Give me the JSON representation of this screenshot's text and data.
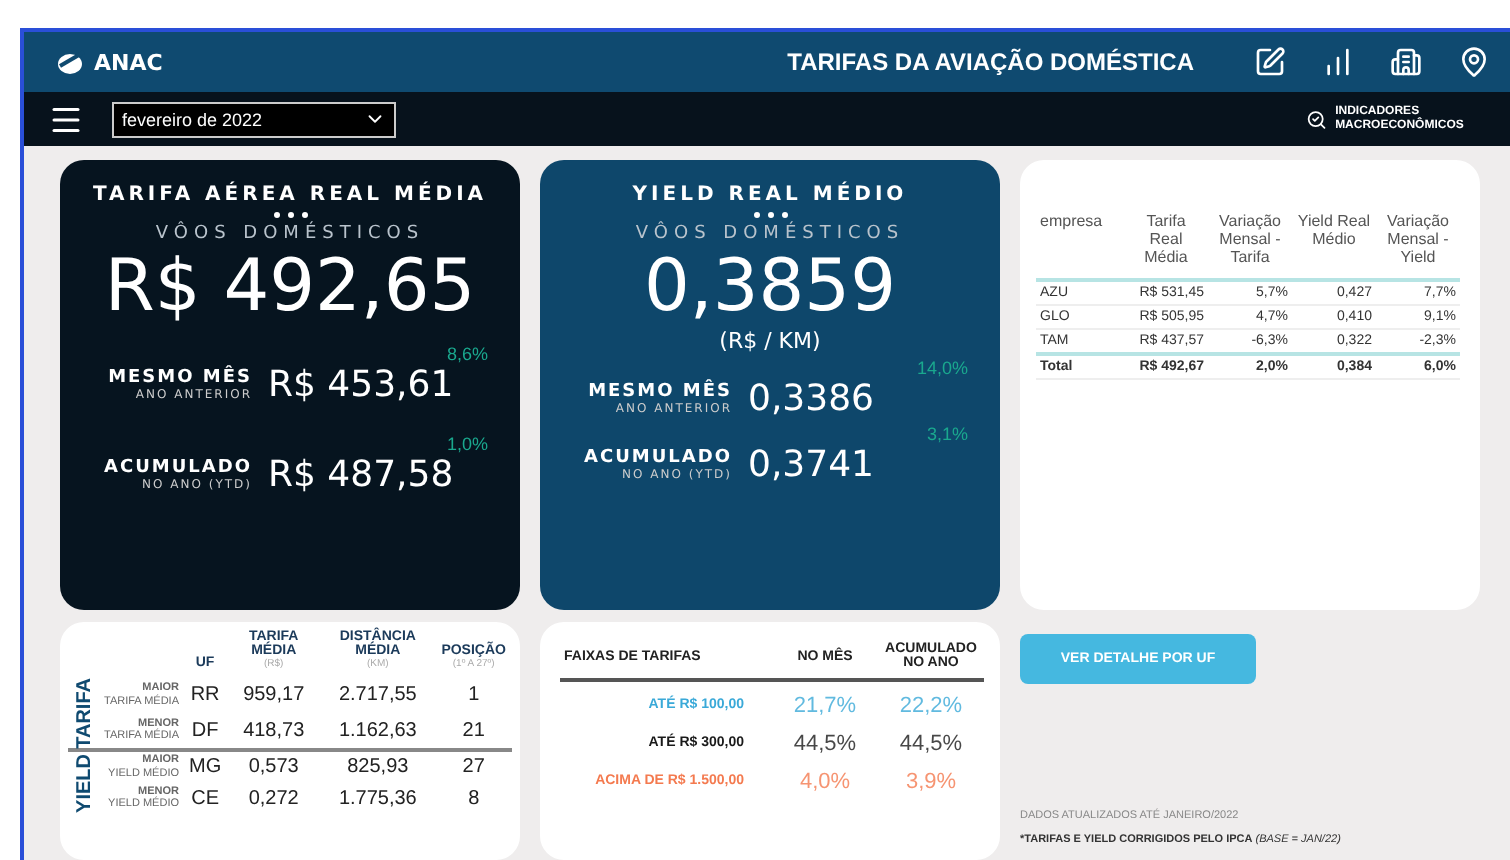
{
  "header": {
    "logo": "ANAC",
    "title": "TARIFAS DA AVIAÇÃO DOMÉSTICA"
  },
  "toolbar": {
    "period": "fevereiro de 2022",
    "link": "INDICADORES MACROECONÔMICOS"
  },
  "kpis": [
    {
      "kind": "tarifa",
      "title": "TARIFA AÉREA REAL MÉDIA",
      "subtitle": "VÔOS DOMÉSTICOS",
      "big": "R$ 492,65",
      "rows": [
        {
          "label": "MESMO MÊS",
          "sub": "ANO ANTERIOR",
          "value": "R$ 453,61",
          "change": "8,6%"
        },
        {
          "label": "ACUMULADO",
          "sub": "NO ANO (YTD)",
          "value": "R$ 487,58",
          "change": "1,0%"
        }
      ]
    },
    {
      "kind": "yield",
      "title": "YIELD REAL MÉDIO",
      "subtitle": "VÔOS DOMÉSTICOS",
      "big": "0,3859",
      "unit": "(R$ / KM)",
      "rows": [
        {
          "label": "MESMO MÊS",
          "sub": "ANO ANTERIOR",
          "value": "0,3386",
          "change": "14,0%"
        },
        {
          "label": "ACUMULADO",
          "sub": "NO ANO (YTD)",
          "value": "0,3741",
          "change": "3,1%"
        }
      ]
    }
  ],
  "company_table": {
    "columns": [
      "empresa",
      "Tarifa Real Média",
      "Variação Mensal - Tarifa",
      "Yield Real Médio",
      "Variação Mensal - Yield"
    ],
    "rows": [
      [
        "AZU",
        "R$ 531,45",
        "5,7%",
        "0,427",
        "7,7%"
      ],
      [
        "GLO",
        "R$ 505,95",
        "4,7%",
        "0,410",
        "9,1%"
      ],
      [
        "TAM",
        "R$ 437,57",
        "-6,3%",
        "0,322",
        "-2,3%"
      ]
    ],
    "total": [
      "Total",
      "R$ 492,67",
      "2,0%",
      "0,384",
      "6,0%"
    ]
  },
  "uf_table": {
    "columns": [
      {
        "title": "UF"
      },
      {
        "title": "TARIFA MÉDIA",
        "sub": "(R$)"
      },
      {
        "title": "DISTÂNCIA MÉDIA",
        "sub": "(KM)"
      },
      {
        "title": "POSIÇÃO",
        "sub": "(1º A 27º)"
      }
    ],
    "sections": [
      {
        "label": "TARIFA",
        "rows": [
          {
            "top": "MAIOR",
            "bottom": "TARIFA MÉDIA",
            "cells": [
              "RR",
              "959,17",
              "2.717,55",
              "1"
            ]
          },
          {
            "top": "MENOR",
            "bottom": "TARIFA MÉDIA",
            "cells": [
              "DF",
              "418,73",
              "1.162,63",
              "21"
            ]
          }
        ]
      },
      {
        "label": "YIELD",
        "rows": [
          {
            "top": "MAIOR",
            "bottom": "YIELD MÉDIO",
            "cells": [
              "MG",
              "0,573",
              "825,93",
              "27"
            ]
          },
          {
            "top": "MENOR",
            "bottom": "YIELD MÉDIO",
            "cells": [
              "CE",
              "0,272",
              "1.775,36",
              "8"
            ]
          }
        ]
      }
    ]
  },
  "fare_bands": {
    "columns": [
      "FAIXAS DE TARIFAS",
      "NO MÊS",
      "ACUMULADO NO ANO"
    ],
    "rows": [
      {
        "label": "ATÉ R$ 100,00",
        "month": "21,7%",
        "year": "22,2%",
        "color": "#3aa9d8"
      },
      {
        "label": "ATÉ R$ 300,00",
        "month": "44,5%",
        "year": "44,5%",
        "color": "#1a1a1a"
      },
      {
        "label": "ACIMA DE R$ 1.500,00",
        "month": "4,0%",
        "year": "3,9%",
        "color": "#f47a4f"
      }
    ]
  },
  "detail_button": "VER DETALHE POR UF",
  "updated": "DADOS ATUALIZADOS ATÉ JANEIRO/2022",
  "footnote": {
    "main": "*TARIFAS E YIELD CORRIGIDOS PELO IPCA",
    "base": "(BASE = JAN/22)"
  }
}
